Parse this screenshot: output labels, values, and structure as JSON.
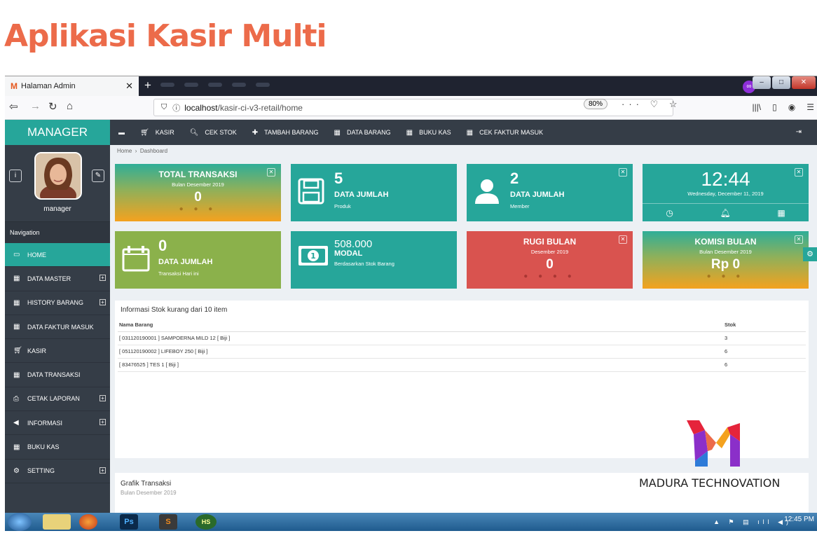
{
  "slide_title": "Aplikasi Kasir Multi",
  "browser": {
    "tab_title": "Halaman Admin",
    "url_host": "localhost",
    "url_path": "/kasir-ci-v3-retail/home",
    "zoom": "80%"
  },
  "sidebar": {
    "brand": "MANAGER",
    "username": "manager",
    "nav_label": "Navigation",
    "items": [
      {
        "label": "HOME",
        "icon": "monitor-icon",
        "active": true,
        "expandable": false
      },
      {
        "label": "DATA MASTER",
        "icon": "grid-icon",
        "expandable": true
      },
      {
        "label": "HISTORY BARANG",
        "icon": "grid-icon",
        "expandable": true
      },
      {
        "label": "DATA FAKTUR MASUK",
        "icon": "grid-icon",
        "expandable": false
      },
      {
        "label": "KASIR",
        "icon": "cart-icon",
        "expandable": false
      },
      {
        "label": "DATA TRANSAKSI",
        "icon": "grid-icon",
        "expandable": false
      },
      {
        "label": "CETAK LAPORAN",
        "icon": "print-icon",
        "expandable": true
      },
      {
        "label": "INFORMASI",
        "icon": "bullhorn-icon",
        "expandable": true
      },
      {
        "label": "BUKU KAS",
        "icon": "grid-icon",
        "expandable": false
      },
      {
        "label": "SETTING",
        "icon": "gears-icon",
        "expandable": true
      }
    ]
  },
  "topmenu": {
    "items": [
      "KASIR",
      "CEK STOK",
      "TAMBAH BARANG",
      "DATA BARANG",
      "BUKU KAS",
      "CEK FAKTUR MASUK"
    ]
  },
  "breadcrumb": {
    "home": "Home",
    "current": "Dashboard"
  },
  "tiles": {
    "total_transaksi": {
      "title": "TOTAL TRANSAKSI",
      "sub": "Bulan Desember 2019",
      "value": "0"
    },
    "produk": {
      "value": "5",
      "label": "DATA JUMLAH",
      "sub": "Produk"
    },
    "member": {
      "value": "2",
      "label": "DATA JUMLAH",
      "sub": "Member"
    },
    "clock": {
      "time": "12:44",
      "date": "Wednesday, December 11, 2019"
    },
    "transaksi_hari": {
      "value": "0",
      "label": "DATA JUMLAH",
      "sub": "Transaksi Hari ini"
    },
    "modal": {
      "value": "508.000",
      "label": "MODAL",
      "sub": "Berdasarkan Stok Barang"
    },
    "rugi": {
      "title": "RUGI BULAN",
      "sub": "Desember 2019",
      "value": "0"
    },
    "komisi": {
      "title": "KOMISI BULAN",
      "sub": "Bulan Desember 2019",
      "value": "Rp 0"
    }
  },
  "stok_panel": {
    "title": "Informasi Stok kurang dari 10 item",
    "columns": [
      "Nama Barang",
      "Stok"
    ],
    "rows": [
      {
        "nama": "[ 031120190001 ] SAMPOERNA MILD 12 [ Biji ]",
        "stok": "3"
      },
      {
        "nama": "[ 051120190002 ] LIFEBOY 250 [ Biji ]",
        "stok": "6"
      },
      {
        "nama": "[ 83476525 ] TES 1 [ Biji ]",
        "stok": "6"
      }
    ]
  },
  "grafik_panel": {
    "title": "Grafik Transaksi",
    "sub": "Bulan Desember 2019"
  },
  "logo_text": "MADURA TECHNOVATION",
  "taskbar": {
    "time": "12:45 PM",
    "apps": [
      "Ps",
      "S",
      "HS"
    ]
  },
  "colors": {
    "accent": "#26a69a",
    "sidebar": "#353d47",
    "title": "#ec6b4a",
    "red": "#d9534f",
    "olive": "#8bb14b"
  }
}
